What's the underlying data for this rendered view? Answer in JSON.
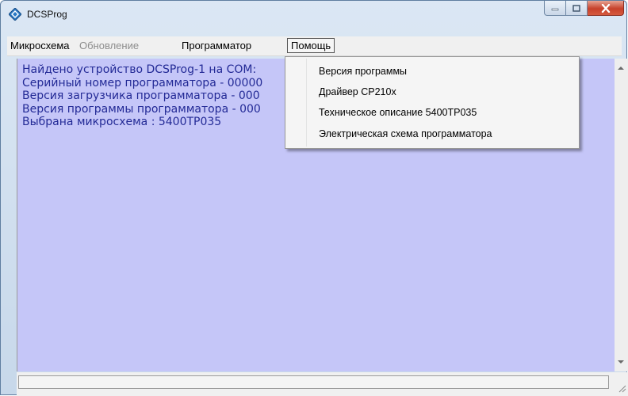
{
  "window": {
    "title": "DCSProg"
  },
  "menubar": {
    "items": [
      {
        "label": "Микросхема",
        "state": "enabled"
      },
      {
        "label": "Обновление",
        "state": "disabled"
      },
      {
        "label": "Программатор",
        "state": "enabled"
      },
      {
        "label": "Помощь",
        "state": "open"
      }
    ]
  },
  "help_menu": {
    "items": [
      {
        "label": "Версия программы"
      },
      {
        "label": "Драйвер CP210x"
      },
      {
        "label": "Техническое описание 5400TP035"
      },
      {
        "label": "Электрическая схема программатора"
      }
    ]
  },
  "log": {
    "lines": [
      "Найдено устройство DCSProg-1 на COM:",
      "Серийный номер программатора - 00000",
      "Версия загрузчика программатора - 000",
      "Версия программы программатора  - 000",
      "Выбрана микросхема : 5400TP035"
    ]
  },
  "icons": {
    "app": "diamond-app-icon",
    "minimize": "minimize-icon",
    "maximize": "maximize-icon",
    "close": "close-icon",
    "scroll_up": "scroll-up-arrow-icon",
    "scroll_down": "scroll-down-arrow-icon",
    "resize": "resize-grip-icon"
  },
  "colors": {
    "log_background": "#c5c6f8",
    "log_text": "#232a96",
    "close_button": "#c7412b"
  }
}
